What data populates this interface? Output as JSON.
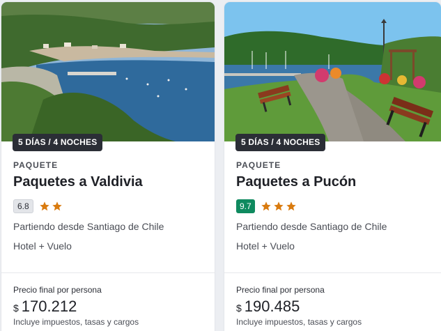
{
  "cards": [
    {
      "duration": "5 DÍAS / 4 NOCHES",
      "type": "PAQUETE",
      "title": "Paquetes a Valdivia",
      "score": "6.8",
      "stars": 2,
      "origin": "Partiendo desde Santiago de Chile",
      "includes": "Hotel + Vuelo",
      "price_label": "Precio final por persona",
      "currency": "$",
      "amount": "170.212",
      "taxes": "Incluye impuestos, tasas y cargos",
      "photo_icon": "coastal-bay-photo"
    },
    {
      "duration": "5 DÍAS / 4 NOCHES",
      "type": "PAQUETE",
      "title": "Paquetes a Pucón",
      "score": "9.7",
      "stars": 3,
      "origin": "Partiendo desde Santiago de Chile",
      "includes": "Hotel + Vuelo",
      "price_label": "Precio final por persona",
      "currency": "$",
      "amount": "190.485",
      "taxes": "Incluye impuestos, tasas y cargos",
      "photo_icon": "lake-park-photo"
    }
  ],
  "colors": {
    "star": "#d97b0f",
    "score_low_bg": "#e3e5e9",
    "score_high_bg": "#0f8a5f",
    "badge_bg": "#2b2e36"
  }
}
